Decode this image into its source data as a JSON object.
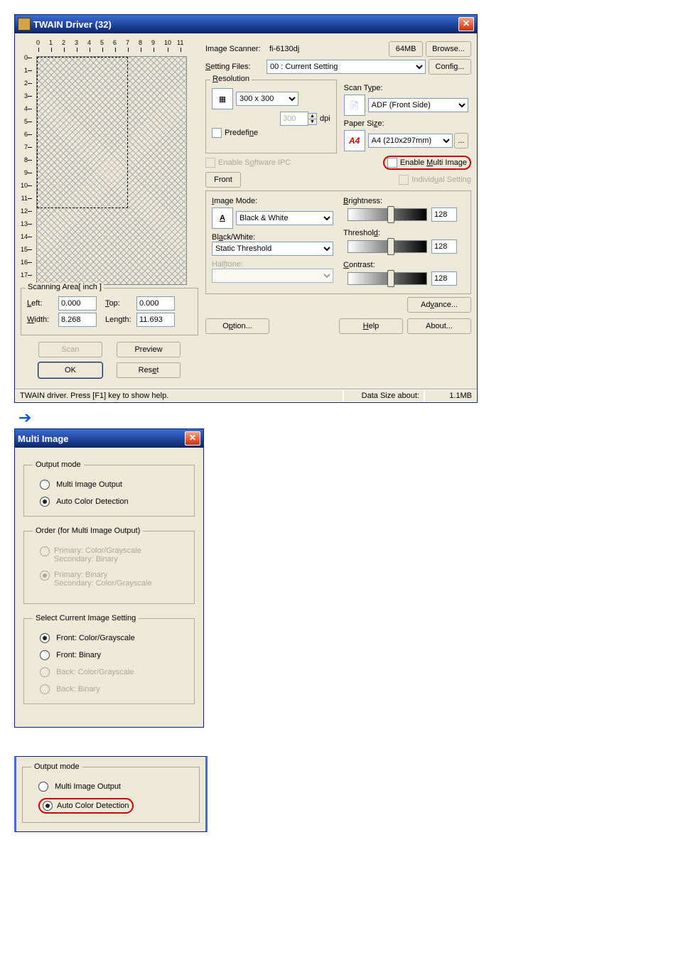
{
  "driverWindow": {
    "title": "TWAIN Driver (32)",
    "memBadge": "64MB",
    "imageScannerLabel": "Image Scanner:",
    "imageScanner": "fi-6130dj",
    "browse": "Browse...",
    "settingFilesLabel": "Setting Files:",
    "settingFiles": "00 : Current Setting",
    "config": "Config...",
    "resolutionLabel": "Resolution",
    "resolutionValue": "300 x 300",
    "dpiValue": "300",
    "dpiLabel": "dpi",
    "predefine": "Predefine",
    "enableSoftwareIPC": "Enable Software IPC",
    "scanTypeLabel": "Scan Type:",
    "scanTypeValue": "ADF (Front Side)",
    "paperSizeLabel": "Paper Size:",
    "paperSizeValue": "A4 (210x297mm)",
    "paperBrowse": "...",
    "enableMultiImage": "Enable Multi Image",
    "frontBtn": "Front",
    "individualSetting": "Individual Setting",
    "imageModeLabel": "Image Mode:",
    "imageModeValue": "Black & White",
    "blackWhiteLabel": "Black/White:",
    "blackWhiteValue": "Static Threshold",
    "halftoneLabel": "Halftone:",
    "halftoneValue": "",
    "brightnessLabel": "Brightness:",
    "brightnessValue": "128",
    "thresholdLabel": "Threshold:",
    "thresholdValue": "128",
    "contrastLabel": "Contrast:",
    "contrastValue": "128",
    "advance": "Advance...",
    "option": "Option...",
    "help": "Help",
    "about": "About...",
    "scanArea": {
      "label": "Scanning Area[ inch ]",
      "left": "Left:",
      "leftVal": "0.000",
      "top": "Top:",
      "topVal": "0.000",
      "width": "Width:",
      "widthVal": "8.268",
      "length": "Length:",
      "lengthVal": "11.693"
    },
    "buttons": {
      "scan": "Scan",
      "preview": "Preview",
      "ok": "OK",
      "reset": "Reset"
    },
    "statusLeft": "TWAIN driver. Press [F1] key to show help.",
    "statusSizeLabel": "Data Size about:",
    "statusSizeVal": "1.1MB"
  },
  "multiWindow": {
    "title": "Multi Image",
    "outputModeLabel": "Output mode",
    "multiImageOutput": "Multi Image Output",
    "autoColorDetection": "Auto Color Detection",
    "orderLabel": "Order (for Multi Image Output)",
    "order1a": "Primary: Color/Grayscale",
    "order1b": "Secondary: Binary",
    "order2a": "Primary: Binary",
    "order2b": "Secondary: Color/Grayscale",
    "selectCurrentLabel": "Select Current Image Setting",
    "frontColor": "Front: Color/Grayscale",
    "frontBinary": "Front: Binary",
    "backColor": "Back: Color/Grayscale",
    "backBinary": "Back: Binary"
  },
  "outputFragment": {
    "label": "Output mode",
    "opt1": "Multi Image Output",
    "opt2": "Auto Color Detection"
  }
}
